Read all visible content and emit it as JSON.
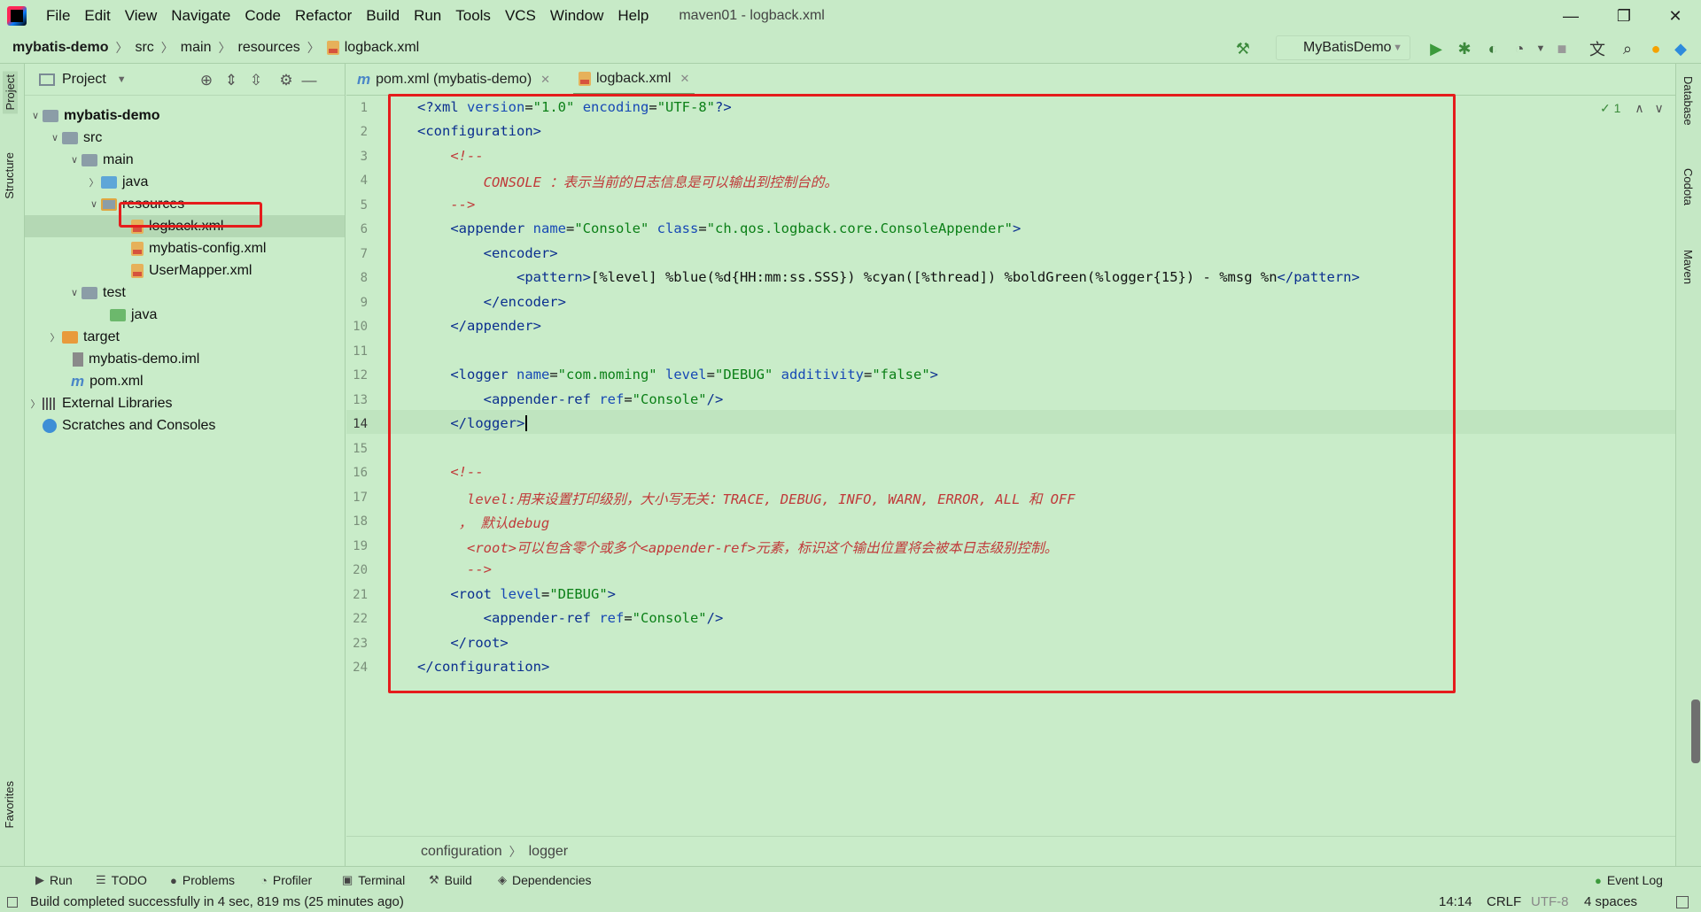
{
  "window": {
    "title": "maven01 - logback.xml",
    "menu": [
      "File",
      "Edit",
      "View",
      "Navigate",
      "Code",
      "Refactor",
      "Build",
      "Run",
      "Tools",
      "VCS",
      "Window",
      "Help"
    ],
    "controls": {
      "minimize": "—",
      "maximize": "❐",
      "close": "✕"
    }
  },
  "navbar": {
    "breadcrumbs": [
      "mybatis-demo",
      "src",
      "main",
      "resources",
      "logback.xml"
    ],
    "run_config": "MyBatisDemo"
  },
  "left_stripe": {
    "project": "Project",
    "structure": "Structure",
    "favorites": "Favorites"
  },
  "right_stripe": {
    "database": "Database",
    "codota": "Codota",
    "maven": "Maven"
  },
  "project_panel": {
    "title": "Project",
    "tree": [
      {
        "label": "mybatis-demo",
        "bold": true
      },
      {
        "label": "src"
      },
      {
        "label": "main"
      },
      {
        "label": "java"
      },
      {
        "label": "resources"
      },
      {
        "label": "logback.xml"
      },
      {
        "label": "mybatis-config.xml"
      },
      {
        "label": "UserMapper.xml"
      },
      {
        "label": "test"
      },
      {
        "label": "java"
      },
      {
        "label": "target"
      },
      {
        "label": "mybatis-demo.iml"
      },
      {
        "label": "pom.xml"
      },
      {
        "label": "External Libraries"
      },
      {
        "label": "Scratches and Consoles"
      }
    ]
  },
  "tabs": [
    {
      "label": "pom.xml (mybatis-demo)",
      "active": false
    },
    {
      "label": "logback.xml",
      "active": true
    }
  ],
  "inspection": "1",
  "editor": {
    "line_numbers": [
      "1",
      "2",
      "3",
      "4",
      "5",
      "6",
      "7",
      "8",
      "9",
      "10",
      "11",
      "12",
      "13",
      "14",
      "15",
      "16",
      "17",
      "18",
      "19",
      "20",
      "21",
      "22",
      "23",
      "24"
    ],
    "current_line": 14
  },
  "editor_breadcrumbs": [
    "configuration",
    "logger"
  ],
  "bottom_tools": [
    "Run",
    "TODO",
    "Problems",
    "Profiler",
    "Terminal",
    "Build",
    "Dependencies",
    "Event Log"
  ],
  "status": {
    "message": "Build completed successfully in 4 sec, 819 ms (25 minutes ago)",
    "position": "14:14",
    "line_sep": "CRLF",
    "encoding": "UTF-8",
    "indent": "4 spaces"
  }
}
